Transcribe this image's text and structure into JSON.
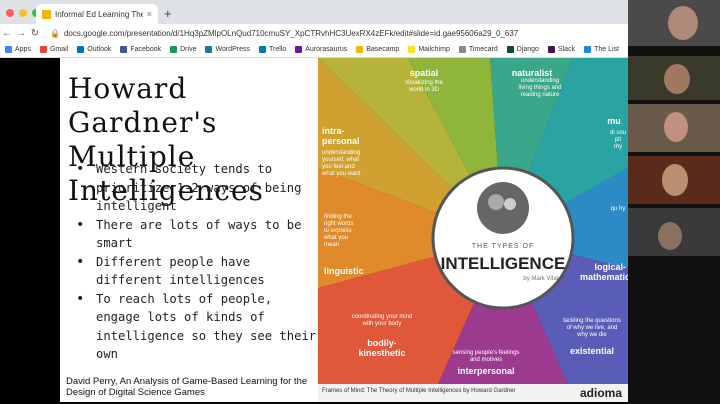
{
  "browser": {
    "tab_title": "Informal Ed Learning Theories",
    "tab_close": "×",
    "new_tab": "+",
    "url": "docs.google.com/presentation/d/1Hq3pZMlpOLnQud710cmuSY_XpCTRvhHC3UexRX4zEFk/edit#slide=id.gae95606a29_0_637",
    "bookmarks": [
      "Apps",
      "Gmail",
      "Outlook",
      "Facebook",
      "Drive",
      "WordPress",
      "Trello",
      "Aurorasaurus",
      "Basecamp",
      "Mailchimp",
      "Timecard",
      "Django",
      "Slack",
      "The List"
    ]
  },
  "slide": {
    "title_line1": "Howard Gardner's",
    "title_line2": "Multiple Intelligences",
    "bullets": [
      " Western society tends to prioritize 1-2 ways of being intelligent",
      "There are lots of ways to be smart",
      "Different people have different intelligences",
      "To reach lots of people, engage lots of kinds of intelligence so they see their own"
    ],
    "citation": "David Perry, An Analysis of Game-Based Learning for the Design of Digital Science Games"
  },
  "infographic": {
    "center_top": "THE TYPES OF",
    "center_main": "INTELLIGENCE",
    "center_by": "by Mark Vital",
    "segments": {
      "spatial": {
        "label": "spatial",
        "desc": "visualizing the world in 3D"
      },
      "naturalist": {
        "label": "naturalist",
        "desc": "understanding living things and reading nature"
      },
      "musical": {
        "label": "mu",
        "desc": "di sou pit rhy"
      },
      "intrapersonal": {
        "label": "intra-personal",
        "desc": "understanding yourself, what you feel and what you want"
      },
      "linguistic": {
        "label": "linguistic",
        "desc": "finding the right words to express what you mean"
      },
      "logical": {
        "label": "logical-mathematical",
        "desc": "qu hy"
      },
      "bodily": {
        "label": "bodily-kinesthetic",
        "desc": "coordinating your mind with your body"
      },
      "interpersonal": {
        "label": "interpersonal",
        "desc": "sensing people's feelings and motives"
      },
      "existential": {
        "label": "existential",
        "desc": "tackling the questions of why we live, and why we die"
      }
    },
    "footer": "Frames of Mind: The Theory of Multiple Intelligences   by Howard Gardner",
    "brand": "adioma"
  }
}
